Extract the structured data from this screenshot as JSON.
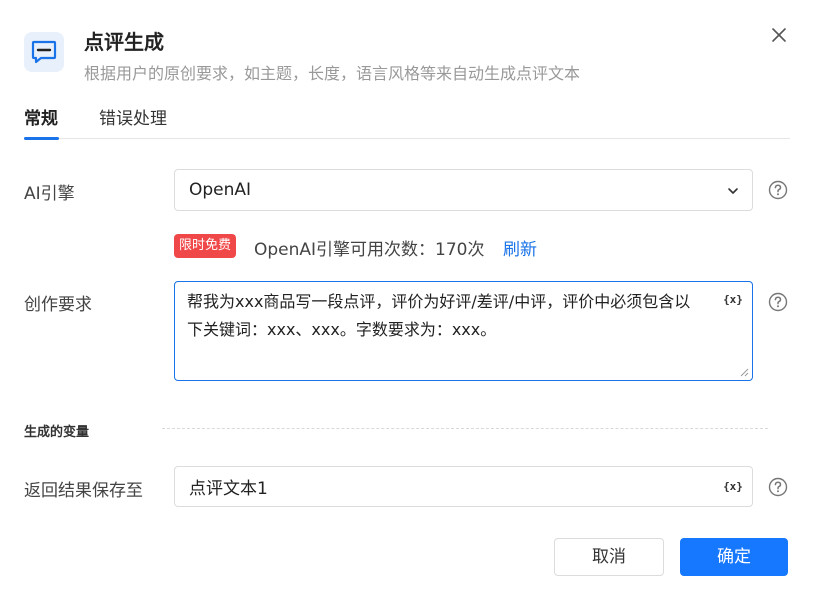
{
  "dialog": {
    "title": "点评生成",
    "subtitle": "根据用户的原创要求，如主题，长度，语言风格等来自动生成点评文本",
    "icon": "comment-icon",
    "accent_color": "#1a73e8"
  },
  "tabs": [
    {
      "label": "常规",
      "active": true
    },
    {
      "label": "错误处理",
      "active": false
    }
  ],
  "engine": {
    "label": "AI引擎",
    "value": "OpenAI",
    "badge": "限时免费",
    "quota_text": "OpenAI引擎可用次数：170次",
    "refresh_label": "刷新"
  },
  "prompt": {
    "label": "创作要求",
    "value": "帮我为xxx商品写一段点评，评价为好评/差评/中评，评价中必须包含以下关键词：xxx、xxx。字数要求为：xxx。",
    "var_button": "{x}"
  },
  "output": {
    "section_title": "生成的变量",
    "label": "返回结果保存至",
    "value": "点评文本1",
    "var_button": "{x}"
  },
  "footer": {
    "cancel_label": "取消",
    "ok_label": "确定"
  }
}
